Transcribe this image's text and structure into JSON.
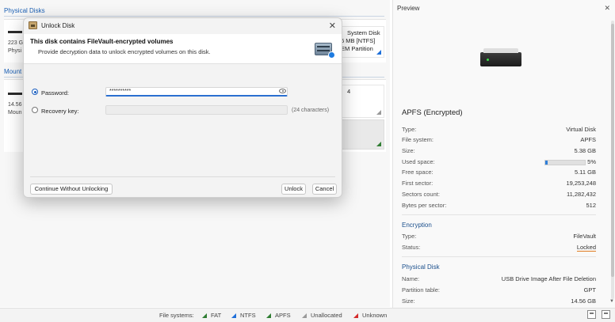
{
  "app": {
    "physical_disks_title": "Physical Disks",
    "mounted_title": "Mount",
    "disk1": {
      "size": "223 G",
      "label": "Physi"
    },
    "disk2": {
      "size": "14.56",
      "label": "Moun"
    },
    "part1": {
      "line1": "System Disk",
      "line2": "6 MB [NTFS]",
      "line3": "EM Partition"
    },
    "part2": {
      "line1": "4"
    }
  },
  "preview": {
    "title": "Preview",
    "volume_name": "APFS (Encrypted)",
    "rows": [
      {
        "key": "Type:",
        "value": "Virtual Disk"
      },
      {
        "key": "File system:",
        "value": "APFS"
      },
      {
        "key": "Size:",
        "value": "5.38 GB"
      },
      {
        "key": "Used space:",
        "value": "5%"
      },
      {
        "key": "Free space:",
        "value": "5.11 GB"
      },
      {
        "key": "First sector:",
        "value": "19,253,248"
      },
      {
        "key": "Sectors count:",
        "value": "11,282,432"
      },
      {
        "key": "Bytes per sector:",
        "value": "512"
      }
    ],
    "used_fraction": 0.05,
    "encryption": {
      "title": "Encryption",
      "type_key": "Type:",
      "type_value": "FileVault",
      "status_key": "Status:",
      "status_value": "Locked"
    },
    "physical_disk": {
      "title": "Physical Disk",
      "name_key": "Name:",
      "name_value": "USB Drive Image After File Deletion",
      "pt_key": "Partition table:",
      "pt_value": "GPT",
      "size_key": "Size:",
      "size_value": "14.56 GB"
    }
  },
  "statusbar": {
    "label": "File systems:",
    "legend": [
      {
        "name": "FAT",
        "color": "#2f7d32"
      },
      {
        "name": "NTFS",
        "color": "#1e6fd9"
      },
      {
        "name": "APFS",
        "color": "#2f7d32"
      },
      {
        "name": "Unallocated",
        "color": "#999999"
      },
      {
        "name": "Unknown",
        "color": "#d42a2a"
      }
    ]
  },
  "dialog": {
    "title": "Unlock Disk",
    "heading": "This disk contains FileVault-encrypted volumes",
    "description": "Provide decryption data to unlock encrypted volumes on this disk.",
    "password_label": "Password:",
    "password_value": "**********",
    "recovery_label": "Recovery key:",
    "recovery_hint": "(24 characters)",
    "continue_button": "Continue Without Unlocking",
    "unlock_button": "Unlock",
    "cancel_button": "Cancel"
  }
}
